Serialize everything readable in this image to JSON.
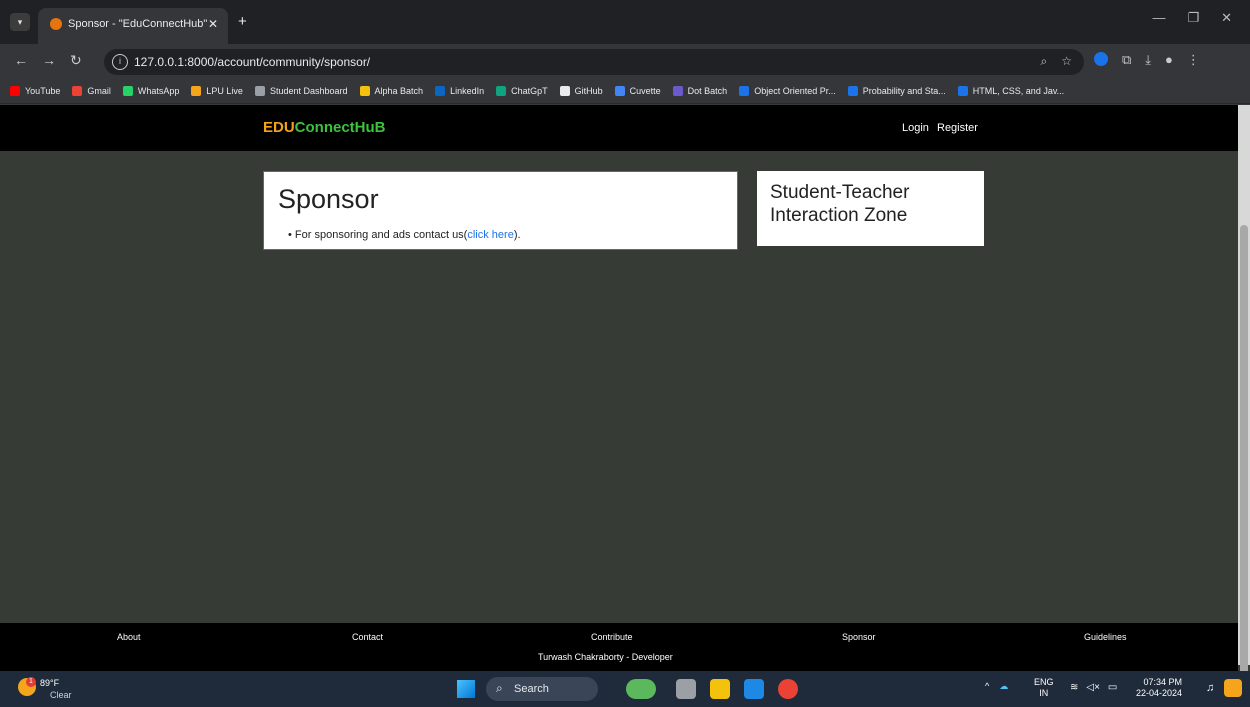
{
  "browser": {
    "tab_title": "Sponsor - \"EduConnectHub\"",
    "url": "127.0.0.1:8000/account/community/sponsor/",
    "bookmarks": [
      {
        "label": "YouTube",
        "color": "#ff0000"
      },
      {
        "label": "Gmail",
        "color": "#ea4335"
      },
      {
        "label": "WhatsApp",
        "color": "#25d366"
      },
      {
        "label": "LPU Live",
        "color": "#f4a51c"
      },
      {
        "label": "Student Dashboard",
        "color": "#9aa0a6"
      },
      {
        "label": "Alpha Batch",
        "color": "#f4c20d"
      },
      {
        "label": "LinkedIn",
        "color": "#0a66c2"
      },
      {
        "label": "ChatGpT",
        "color": "#10a37f"
      },
      {
        "label": "GitHub",
        "color": "#e8eaed"
      },
      {
        "label": "Cuvette",
        "color": "#4285f4"
      },
      {
        "label": "Dot Batch",
        "color": "#6a5acd"
      },
      {
        "label": "Object Oriented Pr...",
        "color": "#1a73e8"
      },
      {
        "label": "Probability and Sta...",
        "color": "#1a73e8"
      },
      {
        "label": "HTML, CSS, and Jav...",
        "color": "#1a73e8"
      }
    ]
  },
  "site": {
    "brand_part1": "EDU",
    "brand_part2": "ConnectHuB",
    "nav_login": "Login",
    "nav_register": "Register"
  },
  "sponsor": {
    "title": "Sponsor",
    "item_text": "For sponsoring and ads contact us(",
    "item_link": "click here",
    "item_end": ")."
  },
  "zone": {
    "title": "Student-Teacher Interaction Zone"
  },
  "footer": {
    "about": "About",
    "contact": "Contact",
    "contribute": "Contribute",
    "sponsor": "Sponsor",
    "guidelines": "Guidelines",
    "credit": "Turwash Chakraborty - Developer"
  },
  "taskbar": {
    "temp": "89°F",
    "condition": "Clear",
    "weather_badge": "1",
    "search_label": "Search",
    "lang_top": "ENG",
    "lang_bottom": "IN",
    "time": "07:34 PM",
    "date": "22-04-2024"
  }
}
